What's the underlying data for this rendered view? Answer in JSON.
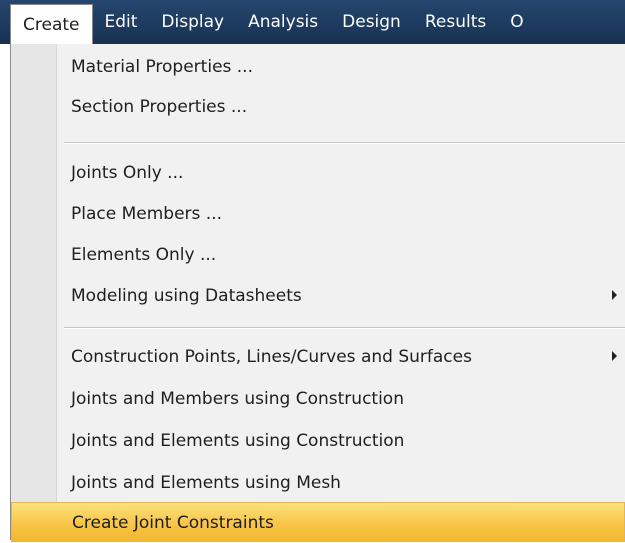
{
  "menubar": {
    "items": [
      "Create",
      "Edit",
      "Display",
      "Analysis",
      "Design",
      "Results",
      "O"
    ]
  },
  "menu": {
    "items": [
      {
        "label": "Material Properties ..."
      },
      {
        "label": "Section Properties ..."
      },
      {
        "label": "Joints Only ..."
      },
      {
        "label": "Place Members ..."
      },
      {
        "label": "Elements Only ..."
      },
      {
        "label": "Modeling using Datasheets",
        "submenu": true
      },
      {
        "label": "Construction Points, Lines/Curves and Surfaces",
        "submenu": true
      },
      {
        "label": "Joints and Members using Construction"
      },
      {
        "label": "Joints and Elements using Construction"
      },
      {
        "label": "Joints and Elements using Mesh"
      },
      {
        "label": "Create Joint Constraints",
        "highlighted": true
      }
    ]
  },
  "icons": {
    "submenu_arrow": "chevron-right-icon"
  },
  "colors": {
    "menubar_bg": "#1d3557",
    "menu_bg": "#f1f1f1",
    "highlight": "#f7c548"
  }
}
